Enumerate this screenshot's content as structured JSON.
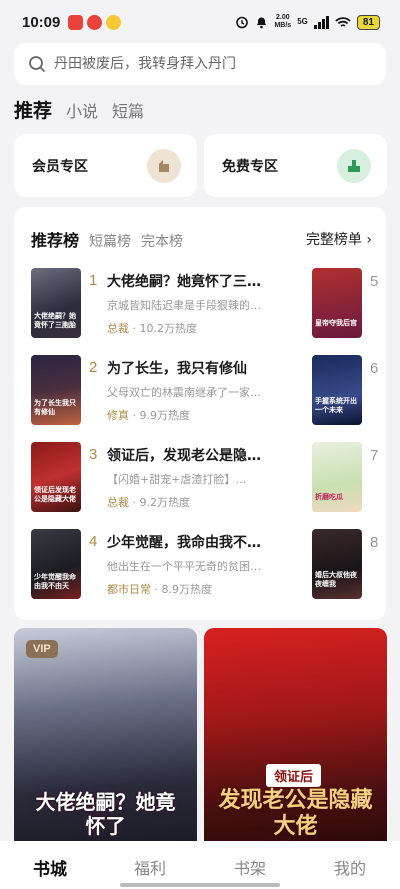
{
  "status_bar": {
    "time": "10:09",
    "net_speed": "2.00",
    "net_unit": "MB/s",
    "network": "5G",
    "battery": "81"
  },
  "search": {
    "placeholder": "丹田被废后，我转身拜入丹门"
  },
  "top_tabs": [
    "推荐",
    "小说",
    "短篇"
  ],
  "zones": {
    "member": "会员专区",
    "free": "免费专区"
  },
  "ranking": {
    "tabs": [
      "推荐榜",
      "短篇榜",
      "完本榜"
    ],
    "full_list": "完整榜单 ›",
    "items": [
      {
        "num": "1",
        "title": "大佬绝嗣？她竟怀了三…",
        "desc": "京城皆知陆迟聿是手段狠辣的…",
        "category": "总裁",
        "heat": " · 10.2万热度"
      },
      {
        "num": "2",
        "title": "为了长生，我只有修仙",
        "desc": "父母双亡的林震南继承了一家…",
        "category": "修真",
        "heat": " · 9.9万热度"
      },
      {
        "num": "3",
        "title": "领证后，发现老公是隐…",
        "desc": "【闪婚+甜宠+虐渣打脸】…",
        "category": "总裁",
        "heat": " · 9.2万热度"
      },
      {
        "num": "4",
        "title": "少年觉醒，我命由我不…",
        "desc": "他出生在一个平平无奇的贫困…",
        "category": "都市日常",
        "heat": " · 8.9万热度"
      }
    ],
    "side_nums": [
      "5",
      "6",
      "7",
      "8"
    ],
    "cover_texts": [
      "大佬绝嗣？她竟怀了三胞胎",
      "为了长生我只有修仙",
      "领证后发现老公是隐藏大佬",
      "少年觉醒我命由我不由天"
    ],
    "side_cover_texts": [
      "皇帝夺我后宫",
      "手握系统开出一个未来",
      "折磨吃瓜",
      "婚后大叔他夜夜缠我"
    ]
  },
  "featured": {
    "left": {
      "badge": "VIP",
      "title": "大佬绝嗣？她竟怀了"
    },
    "right": {
      "tag": "领证后",
      "title": "发现老公是隐藏大佬"
    }
  },
  "bottom_nav": [
    "书城",
    "福利",
    "书架",
    "我的"
  ],
  "colors": {
    "accent_gold": "#b08a4a",
    "page_bg": "#f3f3f5"
  }
}
